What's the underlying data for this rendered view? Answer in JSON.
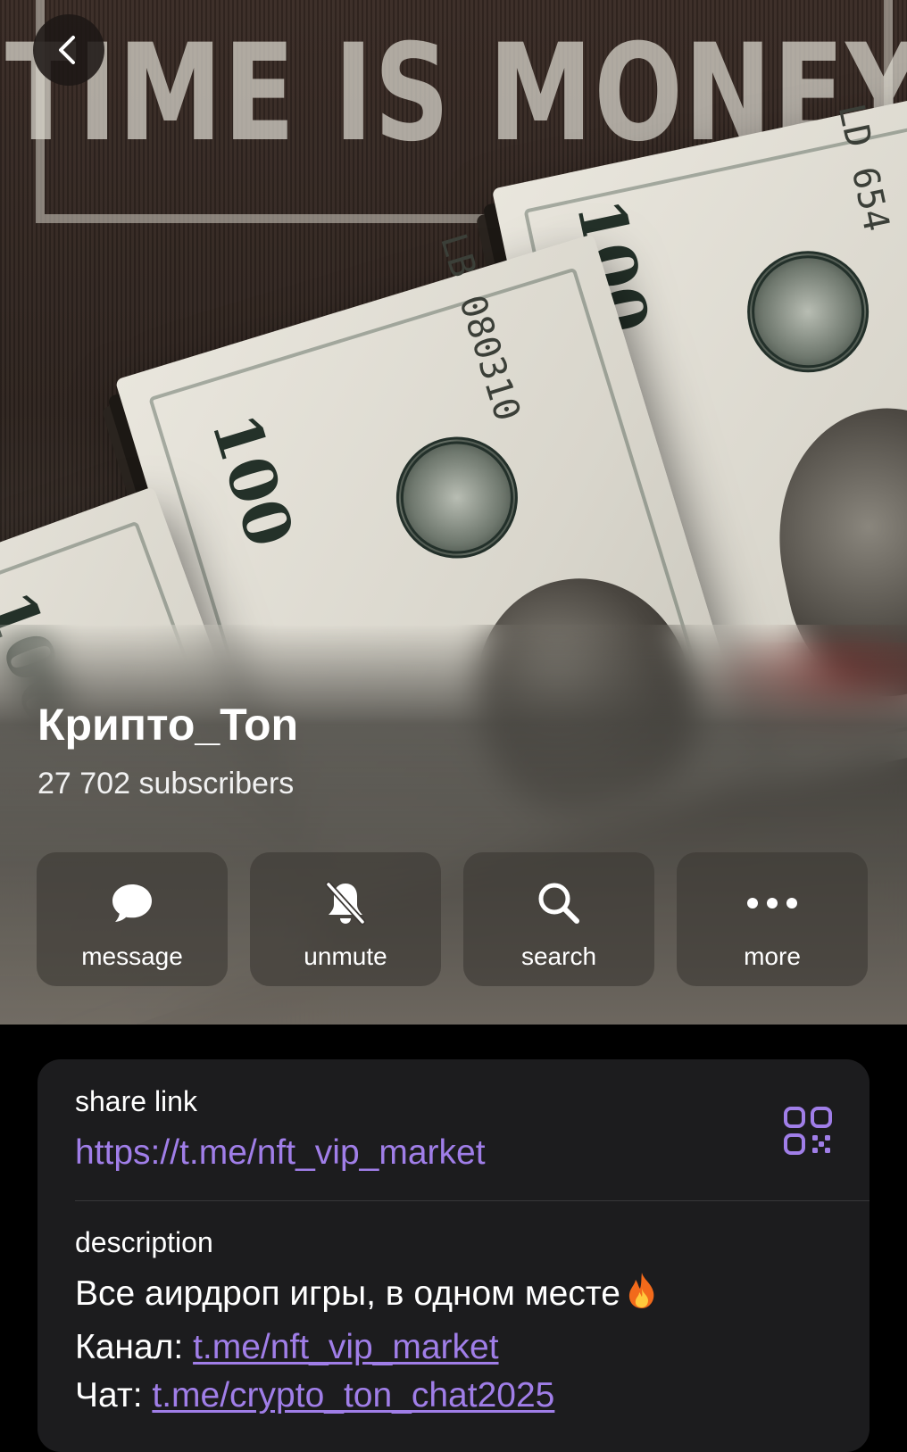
{
  "header": {
    "cover_caption": "TIME IS MONEY",
    "back_icon": "chevron-left-icon"
  },
  "channel": {
    "name": "Крипто_Ton",
    "subscribers": "27 702 subscribers"
  },
  "actions": [
    {
      "label": "message",
      "icon": "chat-bubble-icon"
    },
    {
      "label": "unmute",
      "icon": "bell-slash-icon"
    },
    {
      "label": "search",
      "icon": "search-icon"
    },
    {
      "label": "more",
      "icon": "ellipsis-icon"
    }
  ],
  "info": {
    "share_label": "share link",
    "share_url": "https://t.me/nft_vip_market",
    "qr_icon": "qr-code-icon",
    "description_label": "description",
    "description_line1": "Все аирдроп игры, в одном месте",
    "channel_prefix": "Канал: ",
    "channel_link": "t.me/nft_vip_market",
    "chat_prefix": "Чат: ",
    "chat_link": "t.me/crypto_ton_chat2025"
  },
  "colors": {
    "accent_link": "#a07ee8",
    "card_background": "#1c1c1e",
    "page_background": "#000000"
  }
}
